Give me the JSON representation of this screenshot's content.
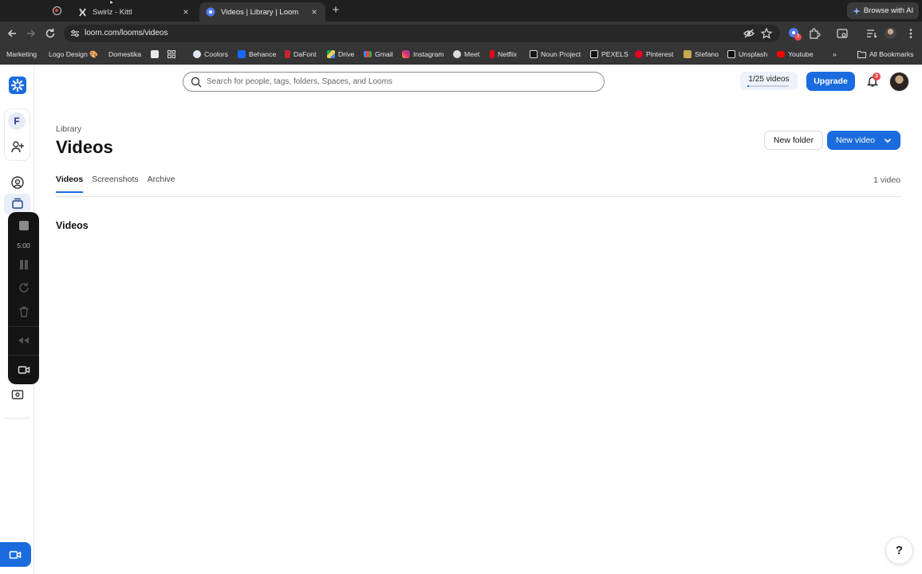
{
  "browser": {
    "tabs": [
      {
        "label": "Swirlz - Kittl",
        "active": false
      },
      {
        "label": "Videos | Library | Loom",
        "active": true
      }
    ],
    "browse_ai": "Browse with AI",
    "url": "loom.com/looms/videos",
    "extension_badge": "3",
    "bookmarks": [
      {
        "label": "Marketing",
        "icon": "none"
      },
      {
        "label": "Logo Design 🎨",
        "icon": "none"
      },
      {
        "label": "Domestika",
        "icon": "none"
      },
      {
        "label": "",
        "icon": "square-icon"
      },
      {
        "label": "",
        "icon": "apps-grid-icon"
      },
      {
        "label": "Coolors",
        "icon": "coolors-icon"
      },
      {
        "label": "Behance",
        "icon": "behance-icon"
      },
      {
        "label": "DaFont",
        "icon": "dafont-icon"
      },
      {
        "label": "Drive",
        "icon": "drive-icon"
      },
      {
        "label": "Gmail",
        "icon": "gmail-icon"
      },
      {
        "label": "Instagram",
        "icon": "instagram-icon"
      },
      {
        "label": "Meet",
        "icon": "meet-icon"
      },
      {
        "label": "Netflix",
        "icon": "netflix-icon"
      },
      {
        "label": "Noun Project",
        "icon": "noun-project-icon"
      },
      {
        "label": "PEXELS",
        "icon": "pexels-icon"
      },
      {
        "label": "Pinterest",
        "icon": "pinterest-icon"
      },
      {
        "label": "Stefano",
        "icon": "stefano-icon"
      },
      {
        "label": "Unsplash",
        "icon": "unsplash-icon"
      },
      {
        "label": "Youtube",
        "icon": "youtube-icon"
      }
    ],
    "all_bookmarks": "All Bookmarks"
  },
  "sidebar": {
    "workspace_initial": "F",
    "recorder": {
      "time": "5:00"
    }
  },
  "header": {
    "search_placeholder": "Search for people, tags, folders, Spaces, and Looms",
    "quota": "1/25 videos",
    "quota_used_fraction": 0.04,
    "upgrade": "Upgrade",
    "notification_count": "3"
  },
  "page": {
    "breadcrumb": "Library",
    "title": "Videos",
    "new_folder": "New folder",
    "new_video": "New video",
    "tabs": [
      {
        "label": "Videos",
        "active": true
      },
      {
        "label": "Screenshots",
        "active": false
      },
      {
        "label": "Archive",
        "active": false
      }
    ],
    "video_count": "1 video",
    "section_title": "Videos"
  },
  "help": "?",
  "colors": {
    "accent": "#1a6cde",
    "badge": "#e5484d",
    "chrome_dark": "#1f1f1f",
    "chrome_mid": "#353535"
  }
}
